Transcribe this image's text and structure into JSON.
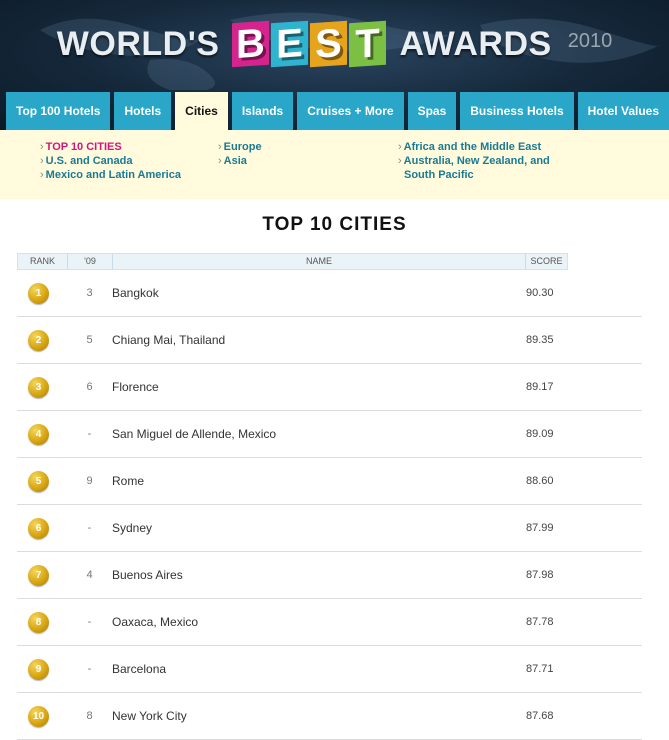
{
  "header": {
    "title_left": "WORLD'S",
    "title_letters": [
      "B",
      "E",
      "S",
      "T"
    ],
    "title_letter_colors": [
      "#d6248f",
      "#2fb3cf",
      "#e6a31c",
      "#7bc043"
    ],
    "title_right": "AWARDS",
    "year": "2010"
  },
  "nav": {
    "tabs": [
      {
        "label": "Top 100 Hotels",
        "active": false
      },
      {
        "label": "Hotels",
        "active": false
      },
      {
        "label": "Cities",
        "active": true
      },
      {
        "label": "Islands",
        "active": false
      },
      {
        "label": "Cruises + More",
        "active": false
      },
      {
        "label": "Spas",
        "active": false
      },
      {
        "label": "Business Hotels",
        "active": false
      },
      {
        "label": "Hotel Values",
        "active": false
      }
    ],
    "colors": {
      "tab": "#2aa6c9",
      "active_tab": "#fffbdc",
      "subnav_bg": "#fffbdc",
      "current_link": "#d4147e",
      "link": "#1a7a94"
    }
  },
  "subnav": {
    "col1": [
      "TOP 10 CITIES",
      "U.S. and Canada",
      "Mexico and Latin America"
    ],
    "col2": [
      "Europe",
      "Asia"
    ],
    "col3": [
      "Africa and the Middle East",
      "Australia, New Zealand, and",
      "South Pacific"
    ]
  },
  "main": {
    "title": "TOP 10 CITIES",
    "columns": {
      "rank": "RANK",
      "prev": "'09",
      "name": "NAME",
      "score": "SCORE"
    },
    "rows": [
      {
        "rank": "1",
        "prev": "3",
        "name": "Bangkok",
        "score": "90.30"
      },
      {
        "rank": "2",
        "prev": "5",
        "name": "Chiang Mai, Thailand",
        "score": "89.35"
      },
      {
        "rank": "3",
        "prev": "6",
        "name": "Florence",
        "score": "89.17"
      },
      {
        "rank": "4",
        "prev": "-",
        "name": "San Miguel de Allende, Mexico",
        "score": "89.09"
      },
      {
        "rank": "5",
        "prev": "9",
        "name": "Rome",
        "score": "88.60"
      },
      {
        "rank": "6",
        "prev": "-",
        "name": "Sydney",
        "score": "87.99"
      },
      {
        "rank": "7",
        "prev": "4",
        "name": "Buenos Aires",
        "score": "87.98"
      },
      {
        "rank": "8",
        "prev": "-",
        "name": "Oaxaca, Mexico",
        "score": "87.78"
      },
      {
        "rank": "9",
        "prev": "-",
        "name": "Barcelona",
        "score": "87.71"
      },
      {
        "rank": "10",
        "prev": "8",
        "name": "New York City",
        "score": "87.68"
      }
    ]
  }
}
